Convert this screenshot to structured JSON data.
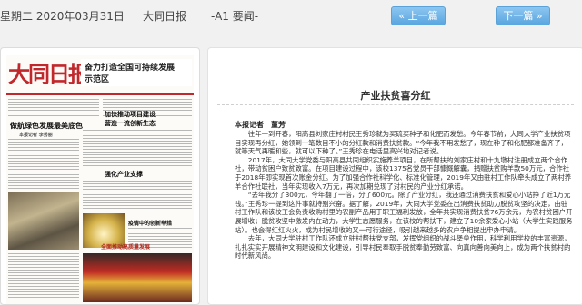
{
  "header": {
    "date": "星期二 2020年03月31日",
    "paper_name": "大同日报",
    "page_label": "-A1 要闻-",
    "prev_label": "上一篇",
    "next_label": "下一篇",
    "prev_arrow": "«",
    "next_arrow": "»"
  },
  "thumbnail": {
    "masthead": "大同日报",
    "top_headline_1": "奋力打造全国可持续发展",
    "top_headline_2": "示范区",
    "left_headline": "做航绿色发展最美底色",
    "left_subhead": "本报记者 李秀丽",
    "right_headline_1": "加快推动项目建设",
    "right_headline_2": "营造一流创新生态",
    "right_headline_3": "强化产业支撑",
    "mid_headline": "疫情中的创新举措",
    "bottom_headline": "全面推动高质量发展"
  },
  "article": {
    "title": "产业扶贫喜分红",
    "byline": "本报记者　董芳",
    "paragraphs": [
      "往年一到开春，阳高县刘家庄村村民王秀珍就为买硫买种子和化肥而发愁。今年春节前，大同大学产业扶贫项目实现再分红，她领到一笔数目不小的分红款和消费扶贫款。“今年我不用发愁了，现在种子和化肥都准备齐了，就等天气再暖和些，就可以下种了。”王秀珍在电话里高兴地对记者说。",
      "2017年，大同大学党委与阳高县共同组织实施养羊项目，在所帮扶的刘家庄村和十九墩村注册成立两个合作社，带动贫困户致贫致富。在项目建设过程中，该校1375名党员干部慷慨解囊，捐赠扶贫购羊款50万元，合作社于2018年即实现首次账金分红。为了加强合作社科学化、标准化管理，2019年又由驻村工作队牵头成立了两村养羊合作社联社，当年实现收入7万元，再次加期兑现了对村民的产业分红承诺。",
      "“去年我分了300元，今年翻了一倍，分了600元。除了产业分红，我还通过消费扶贫和爱心小站挣了近1万元钱。”王秀珍一提到这件事就特别兴奋。据了解，2019年，大同大学党委在出消费扶贫助力脱贫攻坚的决定，由驻村工作队和该校工会负责收购村里的农副产品用于职工福利发放，全年共实现消费扶贫76万余元，为农村贫困户开展增收；脱贫攻坚中激发内在动力，大学生志愿服务，在该校的帮扶下，建立了10余家爱心小站（大学生实践服务站）。也会得红红火火，成为村民增收的又一可行途径，吸引越来越多的农户争相提出申办申请。",
      "去年，大同大学驻村工作队还成立驻村帮扶党支部，发挥党组织的战斗堡垒作用，科学利用学校的丰富资源，扎扎实实开展精神文明建设和文化建设，引导村民奉取手脱贫奉勤劳致富、向真向善向美向上，成为两个扶贫村的时代新风尚。"
    ]
  }
}
